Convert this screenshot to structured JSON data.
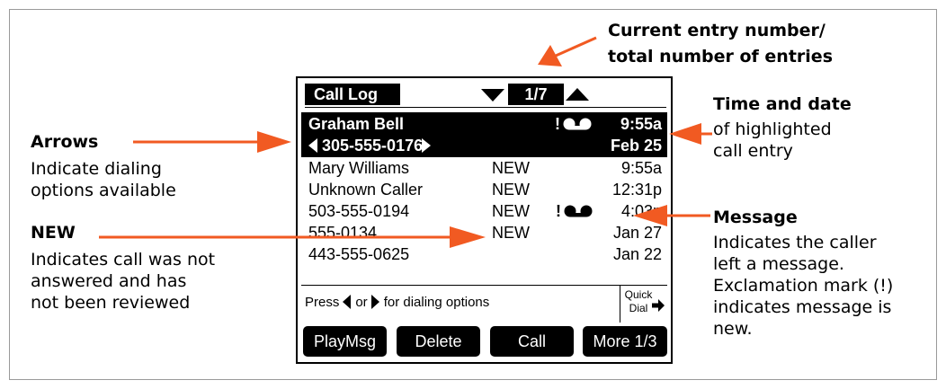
{
  "annotations": {
    "entry_number": {
      "line1": "Current entry number/",
      "line2": "total number of entries"
    },
    "arrows": {
      "title": "Arrows",
      "line1": "Indicate dialing",
      "line2": "options available"
    },
    "time_date": {
      "title": "Time and date",
      "line1": "of highlighted",
      "line2": "call entry"
    },
    "new": {
      "title": "NEW",
      "line1": "Indicates call was not",
      "line2": "answered and has",
      "line3": "not been reviewed"
    },
    "message": {
      "title": "Message",
      "line1": "Indicates the caller",
      "line2": "left a message.",
      "line3": "Exclamation mark (!)",
      "line4": "indicates message is",
      "line5": "new."
    }
  },
  "screen": {
    "title": "Call Log",
    "pager": "1/7",
    "highlighted": {
      "name": "Graham Bell",
      "number": "305-555-0176",
      "time": "9:55a",
      "date": "Feb 25",
      "flag": "!"
    },
    "rows": [
      {
        "name": "Mary Williams",
        "status": "NEW",
        "time": "9:55a",
        "flag": ""
      },
      {
        "name": "Unknown Caller",
        "status": "NEW",
        "time": "12:31p",
        "flag": ""
      },
      {
        "name": "503-555-0194",
        "status": "NEW",
        "time": "4:03p",
        "flag": "!"
      },
      {
        "name": "555-0134",
        "status": "NEW",
        "time": "Jan 27",
        "flag": ""
      },
      {
        "name": "443-555-0625",
        "status": "",
        "time": "Jan 22",
        "flag": ""
      }
    ],
    "hint": {
      "press": "Press",
      "or": "or",
      "rest": "for dialing options"
    },
    "quick_dial": {
      "line1": "Quick",
      "line2": "Dial"
    },
    "softkeys": [
      "PlayMsg",
      "Delete",
      "Call",
      "More 1/3"
    ]
  },
  "colors": {
    "arrow": "#f15a22",
    "frame": "#9a9a9a",
    "screen": "#000000"
  },
  "icons": [
    "voicemail-tape-icon",
    "left-arrow-icon",
    "right-arrow-icon",
    "down-triangle-icon",
    "up-triangle-icon"
  ]
}
